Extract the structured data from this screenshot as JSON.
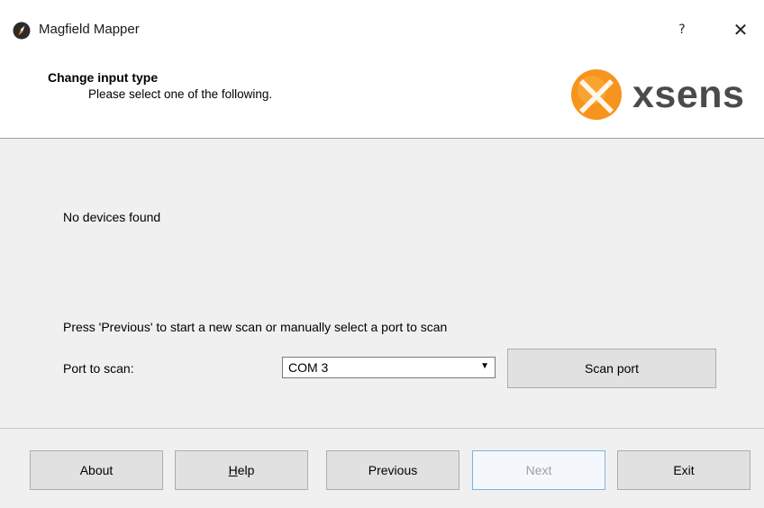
{
  "window": {
    "title": "Magfield Mapper",
    "help_glyph": "?",
    "close_glyph": "✕"
  },
  "header": {
    "title": "Change input type",
    "subtitle": "Please select one of the following.",
    "logo_text": "xsens",
    "logo_color": "#f7941d"
  },
  "content": {
    "status": "No devices found",
    "instruction": "Press 'Previous' to start a new scan or manually select a port to scan",
    "port_label": "Port to scan:",
    "port_value": "COM 3",
    "scan_button": "Scan port"
  },
  "footer": {
    "about": "About",
    "help_first": "H",
    "help_rest": "elp",
    "previous": "Previous",
    "next": "Next",
    "exit": "Exit"
  }
}
